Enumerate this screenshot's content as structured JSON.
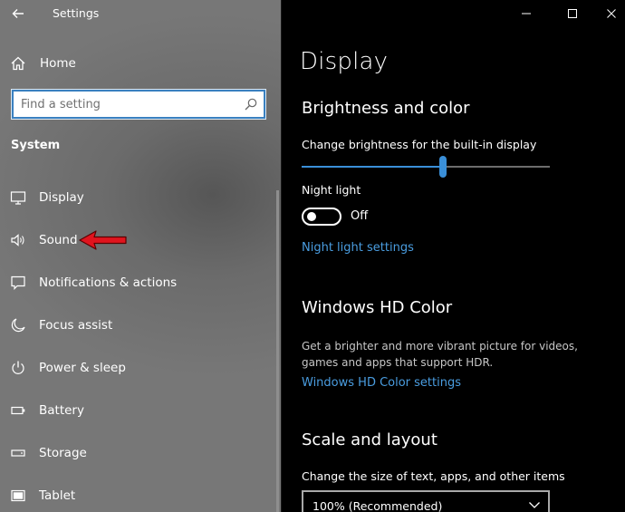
{
  "window": {
    "title": "Settings"
  },
  "sidebar": {
    "home_label": "Home",
    "search": {
      "placeholder": "Find a setting"
    },
    "section_heading": "System",
    "items": [
      {
        "label": "Display",
        "icon": "monitor-icon"
      },
      {
        "label": "Sound",
        "icon": "speaker-icon"
      },
      {
        "label": "Notifications & actions",
        "icon": "notification-icon"
      },
      {
        "label": "Focus assist",
        "icon": "moon-icon"
      },
      {
        "label": "Power & sleep",
        "icon": "power-icon"
      },
      {
        "label": "Battery",
        "icon": "battery-icon"
      },
      {
        "label": "Storage",
        "icon": "storage-icon"
      },
      {
        "label": "Tablet",
        "icon": "tablet-icon"
      }
    ]
  },
  "content": {
    "page_title": "Display",
    "brightness": {
      "heading": "Brightness and color",
      "label": "Change brightness for the built-in display",
      "value": 0.57
    },
    "night_light": {
      "label": "Night light",
      "state": "Off",
      "link": "Night light settings"
    },
    "hdr": {
      "heading": "Windows HD Color",
      "description": "Get a brighter and more vibrant picture for videos, games and apps that support HDR.",
      "link": "Windows HD Color settings"
    },
    "scale": {
      "heading": "Scale and layout",
      "label": "Change the size of text, apps, and other items",
      "selected": "100% (Recommended)"
    }
  },
  "colors": {
    "accent": "#3a8fd8",
    "link": "#4a9de0",
    "annotation_arrow": "#e0141e"
  }
}
